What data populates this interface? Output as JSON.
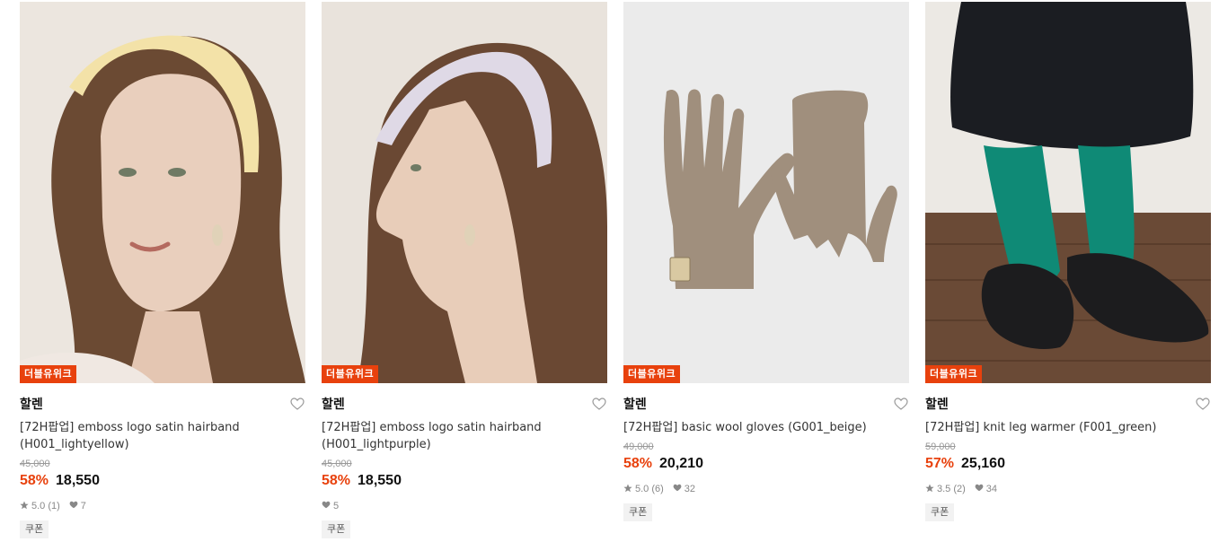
{
  "products": [
    {
      "badge": "더블유위크",
      "brand": "할렌",
      "title_line1": "[72H팝업] emboss logo satin hairband",
      "title_line2": "(H001_lightyellow)",
      "original_price": "45,000",
      "discount": "58%",
      "price": "18,550",
      "rating": "5.0 (1)",
      "likes": "7",
      "coupon": "쿠폰"
    },
    {
      "badge": "더블유위크",
      "brand": "할렌",
      "title_line1": "[72H팝업] emboss logo satin hairband",
      "title_line2": "(H001_lightpurple)",
      "original_price": "45,000",
      "discount": "58%",
      "price": "18,550",
      "rating": "",
      "likes": "5",
      "coupon": "쿠폰"
    },
    {
      "badge": "더블유위크",
      "brand": "할렌",
      "title_line1": "[72H팝업] basic wool gloves (G001_beige)",
      "title_line2": "",
      "original_price": "49,000",
      "discount": "58%",
      "price": "20,210",
      "rating": "5.0 (6)",
      "likes": "32",
      "coupon": "쿠폰"
    },
    {
      "badge": "더블유위크",
      "brand": "할렌",
      "title_line1": "[72H팝업] knit leg warmer (F001_green)",
      "title_line2": "",
      "original_price": "59,000",
      "discount": "57%",
      "price": "25,160",
      "rating": "3.5 (2)",
      "likes": "34",
      "coupon": "쿠폰"
    }
  ],
  "colors": {
    "accent": "#e8410d",
    "text": "#222222",
    "muted": "#999999",
    "coupon_bg": "#f2f2f2"
  }
}
